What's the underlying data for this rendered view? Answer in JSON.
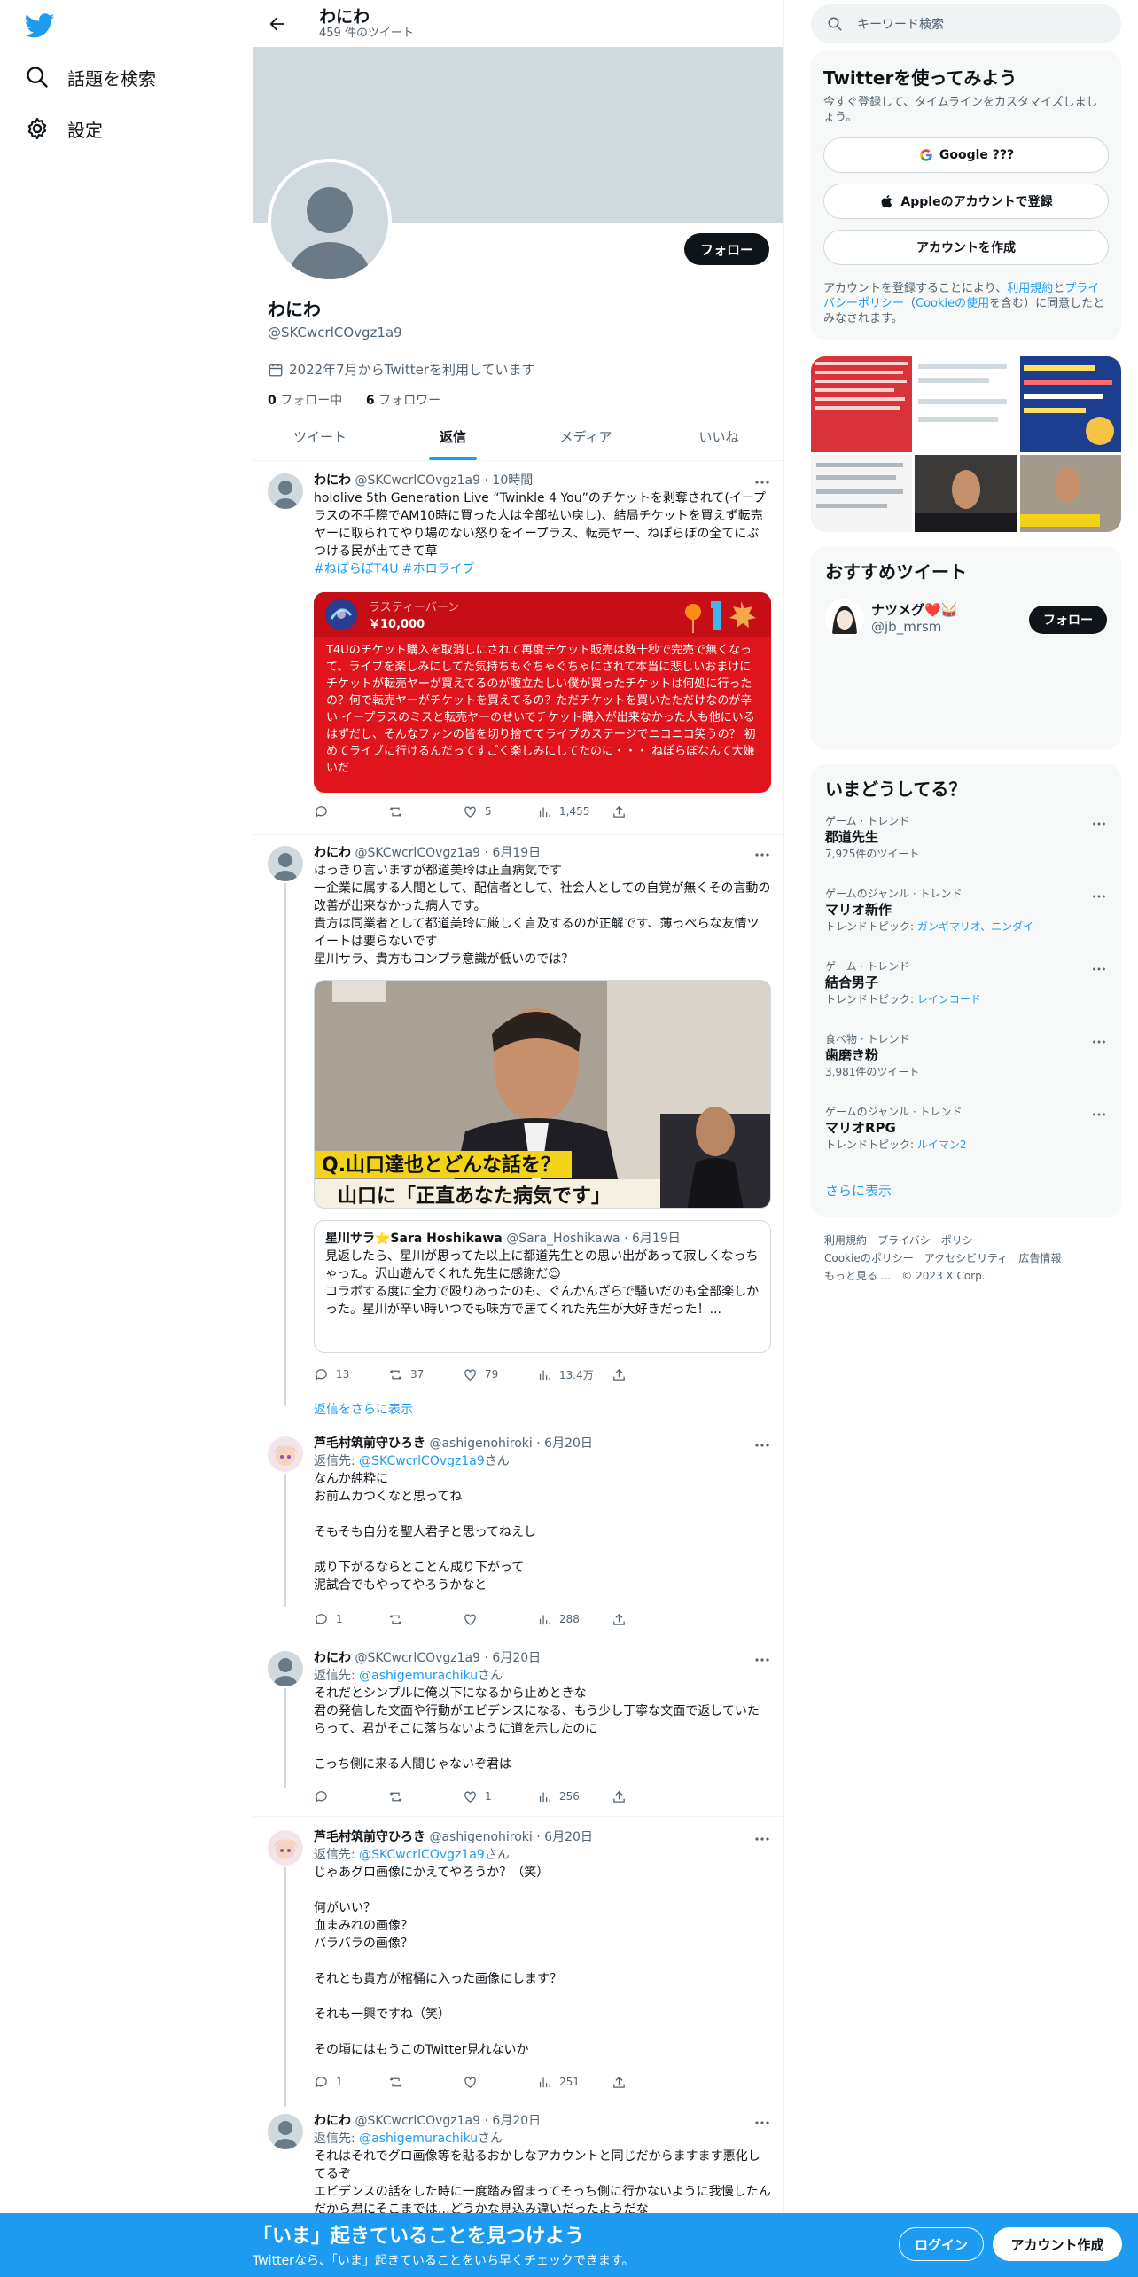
{
  "nav": {
    "items": [
      {
        "label": "話題を検索",
        "icon": "hash-search-icon"
      },
      {
        "label": "設定",
        "icon": "gear-icon"
      }
    ]
  },
  "header": {
    "name": "わにわ",
    "tweet_count": "459 件のツイート"
  },
  "profile": {
    "name": "わにわ",
    "handle": "@SKCwcrlCOvgz1a9",
    "joined": "2022年7月からTwitterを利用しています",
    "following_count": "0",
    "following_label": "フォロー中",
    "followers_count": "6",
    "followers_label": "フォロワー",
    "follow_button": "フォロー"
  },
  "tabs": [
    "ツイート",
    "返信",
    "メディア",
    "いいね"
  ],
  "active_tab": "返信",
  "tweets": [
    {
      "name": "わにわ",
      "handle": "@SKCwcrlCOvgz1a9",
      "time": "10時間",
      "text": "hololive 5th Generation Live “Twinkle 4 You”のチケットを剥奪されて(イープラスの不手際でAM10時に買った人は全部払い戻し)、結局チケットを買えず転売ヤーに取られてやり場のない怒りをイープラス、転売ヤー、ねぽらぼの全てにぶつける民が出てきて草",
      "hashtags": "#ねぽらぼT4U #ホロライブ",
      "ticket_name": "ラスティーバーン",
      "ticket_amount": "￥10,000",
      "ticket_text": "T4Uのチケット購入を取消しにされて再度チケット販売は数十秒で完売で無くなって、ライブを楽しみにしてた気持ちもぐちゃぐちゃにされて本当に悲しいおまけにチケットが転売ヤーが買えてるのが腹立たしい僕が買ったチケットは何処に行ったの？何で転売ヤーがチケットを買えてるの？ただチケットを買いたただけなのが辛い イープラスのミスと転売ヤーのせいでチケット購入が出来なかった人も他にいるはずだし、そんなファンの皆を切り捨ててライブのステージでニコニコ笑うの？ 初めてライブに行けるんだってすごく楽しみにしてたのに・・・ ねぽらぼなんて大嫌いだ",
      "replies": "",
      "retweets": "",
      "likes": "5",
      "views": "1,455"
    },
    {
      "name": "わにわ",
      "handle": "@SKCwcrlCOvgz1a9",
      "time": "6月19日",
      "text": "はっきり言いますが都道美玲は正直病気です\n一企業に属する人間として、配信者として、社会人としての自覚が無くその言動の改善が出来なかった病人です。\n貴方は同業者として都道美玲に厳しく言及するのが正解です、薄っぺらな友情ツイートは要らないです\n星川サラ、貴方もコンプラ意識が低いのでは？",
      "photo_caption": "Q.山口達也とどんな話を？",
      "photo_caption2": "山口に「正直あなた病気です」",
      "quote_name": "星川サラ⭐Sara Hoshikawa",
      "quote_handle": "@Sara_Hoshikawa",
      "quote_time": "6月19日",
      "quote_text": "見返したら、星川が思ってた以上に都道先生との思い出があって寂しくなっちゃった。沢山遊んでくれた先生に感謝だ😌\nコラボする度に全力で殴りあったのも、ぐんかんざらで騒いだのも全部楽しかった。星川が辛い時いつでも味方で居てくれた先生が大好きだった！...",
      "replies": "13",
      "retweets": "37",
      "likes": "79",
      "views": "13.4万"
    },
    {
      "name": "芦毛村筑前守ひろき",
      "handle": "@ashigenohiroki",
      "time": "6月20日",
      "reply_to_label": "返信先: ",
      "reply_to": "@SKCwcrlCOvgz1a9",
      "reply_to_suffix": "さん",
      "text": "なんか純粋に\nお前ムカつくなと思ってね\n\nそもそも自分を聖人君子と思ってねえし\n\n成り下がるならとことん成り下がって\n泥試合でもやってやろうかなと",
      "replies": "1",
      "retweets": "",
      "likes": "",
      "views": "288"
    },
    {
      "name": "わにわ",
      "handle": "@SKCwcrlCOvgz1a9",
      "time": "6月20日",
      "reply_to_label": "返信先: ",
      "reply_to": "@ashigemurachiku",
      "reply_to_suffix": "さん",
      "text": "それだとシンプルに俺以下になるから止めときな\n君の発信した文面や行動がエビデンスになる、もう少し丁寧な文面で返していたらって、君がそこに落ちないように道を示したのに\n\nこっち側に来る人間じゃないぞ君は",
      "replies": "",
      "retweets": "",
      "likes": "1",
      "views": "256"
    },
    {
      "name": "芦毛村筑前守ひろき",
      "handle": "@ashigenohiroki",
      "time": "6月20日",
      "reply_to_label": "返信先: ",
      "reply_to": "@SKCwcrlCOvgz1a9",
      "reply_to_suffix": "さん",
      "text": "じゃあグロ画像にかえてやろうか？（笑）\n\n何がいい？\n血まみれの画像？\nバラバラの画像？\n\nそれとも貴方が棺桶に入った画像にします？\n\nそれも一興ですね（笑）\n\nその頃にはもうこのTwitter見れないか",
      "replies": "1",
      "retweets": "",
      "likes": "",
      "views": "251"
    },
    {
      "name": "わにわ",
      "handle": "@SKCwcrlCOvgz1a9",
      "time": "6月20日",
      "reply_to_label": "返信先: ",
      "reply_to": "@ashigemurachiku",
      "reply_to_suffix": "さん",
      "text": "それはそれでグロ画像等を貼るおかしなアカウントと同じだからますます悪化してるぞ\nエビデンスの話をした時に一度踏み留まってそっち側に行かないように我慢したんだから君にそこまでは…どうかな見込み違いだったようだな",
      "replies": "",
      "retweets": "",
      "likes": "",
      "views": ""
    }
  ],
  "show_more_replies": "返信をさらに表示",
  "search": {
    "placeholder": "キーワード検索"
  },
  "signup": {
    "title": "Twitterを使ってみよう",
    "subtitle": "今すぐ登録して、タイムラインをカスタマイズしましょう。",
    "google_button": "Google ???",
    "apple_button": "Appleのアカウントで登録",
    "create_button": "アカウントを作成",
    "legal_1": "アカウントを登録することにより、",
    "legal_terms": "利用規約",
    "legal_2": "と",
    "legal_privacy": "プライバシーポリシー",
    "legal_3": "（",
    "legal_cookie": "Cookieの使用",
    "legal_4": "を含む）に同意したとみなされます。"
  },
  "recommended": {
    "title": "おすすめツイート",
    "user_name": "ナツメグ❤️🥁",
    "user_handle": "@jb_mrsm",
    "follow_button": "フォロー"
  },
  "trends": {
    "title": "いまどうしてる？",
    "items": [
      {
        "context": "ゲーム · トレンド",
        "name": "郡道先生",
        "sub": "7,925件のツイート",
        "sub_link": ""
      },
      {
        "context": "ゲームのジャンル · トレンド",
        "name": "マリオ新作",
        "sub": "トレンドトピック: ",
        "sub_link": "ガンギマリオ、ニンダイ"
      },
      {
        "context": "ゲーム · トレンド",
        "name": "結合男子",
        "sub": "トレンドトピック: ",
        "sub_link": "レインコード"
      },
      {
        "context": "食べ物 · トレンド",
        "name": "歯磨き粉",
        "sub": "3,981件のツイート",
        "sub_link": ""
      },
      {
        "context": "ゲームのジャンル · トレンド",
        "name": "マリオRPG",
        "sub": "トレンドトピック: ",
        "sub_link": "ルイマン2"
      }
    ],
    "show_more": "さらに表示"
  },
  "footer": {
    "links_row1": [
      "利用規約",
      "プライバシーポリシー"
    ],
    "links_row2": [
      "Cookieのポリシー",
      "アクセシビリティ",
      "広告情報"
    ],
    "more": "もっと見る ...",
    "copyright": "© 2023 X Corp."
  },
  "bottom_bar": {
    "title": "「いま」起きていることを見つけよう",
    "subtitle": "Twitterなら、「いま」起きていることをいち早くチェックできます。",
    "login": "ログイン",
    "signup": "アカウント作成"
  },
  "colors": {
    "accent": "#1d9bf0",
    "text": "#0f1419",
    "muted": "#536471",
    "banner": "#cfd9de",
    "ticket_red": "#e0141c"
  }
}
